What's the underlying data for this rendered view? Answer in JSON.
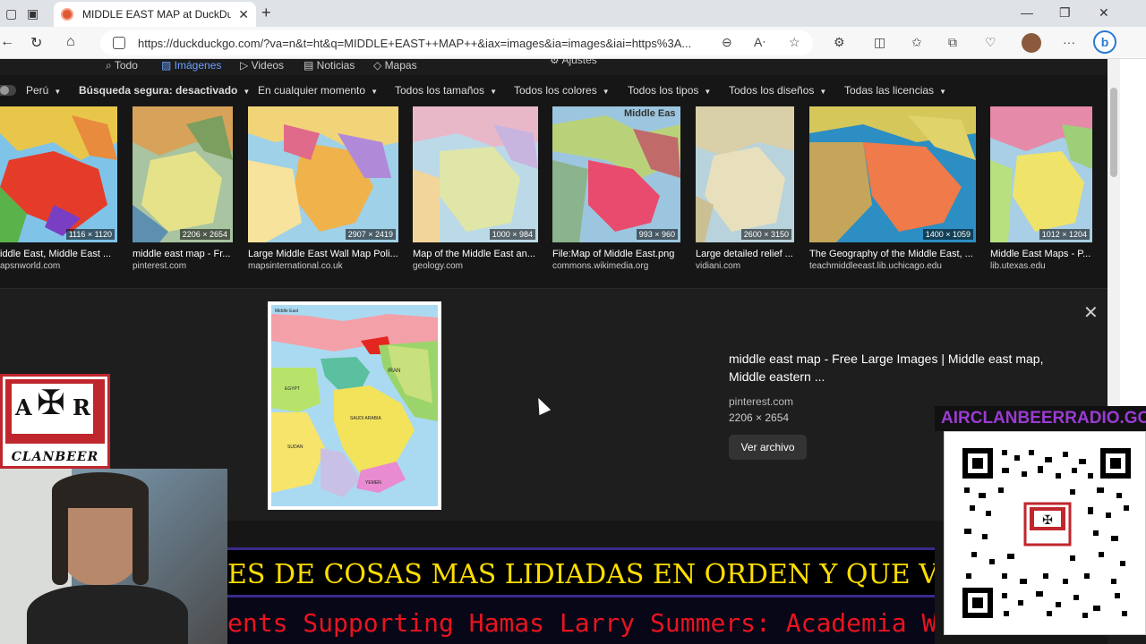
{
  "browser": {
    "tab_title": "MIDDLE EAST MAP at DuckDuck",
    "url": "https://duckduckgo.com/?va=n&t=ht&q=MIDDLE+EAST++MAP++&iax=images&ia=images&iai=https%3A..."
  },
  "search_tabs": {
    "all": "Todo",
    "images": "Imágenes",
    "videos": "Videos",
    "news": "Noticias",
    "maps": "Mapas",
    "settings": "Ajustes"
  },
  "filters": {
    "region": "Perú",
    "safe_search": "Búsqueda segura: desactivado",
    "time": "En cualquier momento",
    "size": "Todos los tamaños",
    "color": "Todos los colores",
    "type": "Todos los tipos",
    "layout": "Todos los diseños",
    "license": "Todas las licencias"
  },
  "results": [
    {
      "title": "iddle East, Middle East ...",
      "site": "apsnworld.com",
      "dims": "1116 × 1120"
    },
    {
      "title": "middle east map - Fr...",
      "site": "pinterest.com",
      "dims": "2206 × 2654"
    },
    {
      "title": "Large Middle East Wall Map Poli...",
      "site": "mapsinternational.co.uk",
      "dims": "2907 × 2419"
    },
    {
      "title": "Map of the Middle East an...",
      "site": "geology.com",
      "dims": "1000 × 984"
    },
    {
      "title": "File:Map of Middle East.png",
      "site": "commons.wikimedia.org",
      "dims": "993 × 960",
      "overlay": "Middle Eas"
    },
    {
      "title": "Large detailed relief ...",
      "site": "vidiani.com",
      "dims": "2600 × 3150"
    },
    {
      "title": "The Geography of the Middle East, ...",
      "site": "teachmiddleeast.lib.uchicago.edu",
      "dims": "1400 × 1059"
    },
    {
      "title": "Middle East Maps - P...",
      "site": "lib.utexas.edu",
      "dims": "1012 × 1204"
    }
  ],
  "detail": {
    "title": "middle east map - Free Large Images | Middle east map, Middle eastern ...",
    "site": "pinterest.com",
    "dims": "2206 × 2654",
    "button": "Ver archivo",
    "map_header": "Middle East",
    "map_labels": [
      "IRAN",
      "EGYPT",
      "SAUDI ARABIA",
      "SUDAN",
      "YEMEN"
    ]
  },
  "overlays": {
    "logo_left": "A",
    "logo_right": "R",
    "logo_name": "CLANBEER",
    "ticker_yellow": "ES DE COSAS MAS LIDIADAS EN ORDEN Y QUE VENC",
    "ticker_red": "ents Supporting Hamas Larry Summers: Academia We",
    "qr_banner": "AIRCLANBEERRADIO.GO"
  },
  "colors": {
    "accent_blue": "#6ea0ff",
    "ticker_yellow": "#ffde00",
    "ticker_red": "#e8141f",
    "banner_purple": "#9a3bd3",
    "logo_red": "#c0262d"
  }
}
